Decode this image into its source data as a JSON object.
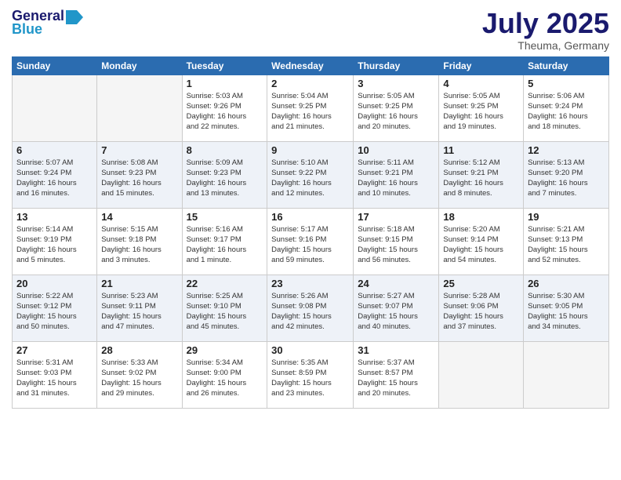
{
  "header": {
    "logo_line1": "General",
    "logo_line2": "Blue",
    "month": "July 2025",
    "location": "Theuma, Germany"
  },
  "days_of_week": [
    "Sunday",
    "Monday",
    "Tuesday",
    "Wednesday",
    "Thursday",
    "Friday",
    "Saturday"
  ],
  "weeks": [
    [
      {
        "day": "",
        "info": ""
      },
      {
        "day": "",
        "info": ""
      },
      {
        "day": "1",
        "info": "Sunrise: 5:03 AM\nSunset: 9:26 PM\nDaylight: 16 hours\nand 22 minutes."
      },
      {
        "day": "2",
        "info": "Sunrise: 5:04 AM\nSunset: 9:25 PM\nDaylight: 16 hours\nand 21 minutes."
      },
      {
        "day": "3",
        "info": "Sunrise: 5:05 AM\nSunset: 9:25 PM\nDaylight: 16 hours\nand 20 minutes."
      },
      {
        "day": "4",
        "info": "Sunrise: 5:05 AM\nSunset: 9:25 PM\nDaylight: 16 hours\nand 19 minutes."
      },
      {
        "day": "5",
        "info": "Sunrise: 5:06 AM\nSunset: 9:24 PM\nDaylight: 16 hours\nand 18 minutes."
      }
    ],
    [
      {
        "day": "6",
        "info": "Sunrise: 5:07 AM\nSunset: 9:24 PM\nDaylight: 16 hours\nand 16 minutes."
      },
      {
        "day": "7",
        "info": "Sunrise: 5:08 AM\nSunset: 9:23 PM\nDaylight: 16 hours\nand 15 minutes."
      },
      {
        "day": "8",
        "info": "Sunrise: 5:09 AM\nSunset: 9:23 PM\nDaylight: 16 hours\nand 13 minutes."
      },
      {
        "day": "9",
        "info": "Sunrise: 5:10 AM\nSunset: 9:22 PM\nDaylight: 16 hours\nand 12 minutes."
      },
      {
        "day": "10",
        "info": "Sunrise: 5:11 AM\nSunset: 9:21 PM\nDaylight: 16 hours\nand 10 minutes."
      },
      {
        "day": "11",
        "info": "Sunrise: 5:12 AM\nSunset: 9:21 PM\nDaylight: 16 hours\nand 8 minutes."
      },
      {
        "day": "12",
        "info": "Sunrise: 5:13 AM\nSunset: 9:20 PM\nDaylight: 16 hours\nand 7 minutes."
      }
    ],
    [
      {
        "day": "13",
        "info": "Sunrise: 5:14 AM\nSunset: 9:19 PM\nDaylight: 16 hours\nand 5 minutes."
      },
      {
        "day": "14",
        "info": "Sunrise: 5:15 AM\nSunset: 9:18 PM\nDaylight: 16 hours\nand 3 minutes."
      },
      {
        "day": "15",
        "info": "Sunrise: 5:16 AM\nSunset: 9:17 PM\nDaylight: 16 hours\nand 1 minute."
      },
      {
        "day": "16",
        "info": "Sunrise: 5:17 AM\nSunset: 9:16 PM\nDaylight: 15 hours\nand 59 minutes."
      },
      {
        "day": "17",
        "info": "Sunrise: 5:18 AM\nSunset: 9:15 PM\nDaylight: 15 hours\nand 56 minutes."
      },
      {
        "day": "18",
        "info": "Sunrise: 5:20 AM\nSunset: 9:14 PM\nDaylight: 15 hours\nand 54 minutes."
      },
      {
        "day": "19",
        "info": "Sunrise: 5:21 AM\nSunset: 9:13 PM\nDaylight: 15 hours\nand 52 minutes."
      }
    ],
    [
      {
        "day": "20",
        "info": "Sunrise: 5:22 AM\nSunset: 9:12 PM\nDaylight: 15 hours\nand 50 minutes."
      },
      {
        "day": "21",
        "info": "Sunrise: 5:23 AM\nSunset: 9:11 PM\nDaylight: 15 hours\nand 47 minutes."
      },
      {
        "day": "22",
        "info": "Sunrise: 5:25 AM\nSunset: 9:10 PM\nDaylight: 15 hours\nand 45 minutes."
      },
      {
        "day": "23",
        "info": "Sunrise: 5:26 AM\nSunset: 9:08 PM\nDaylight: 15 hours\nand 42 minutes."
      },
      {
        "day": "24",
        "info": "Sunrise: 5:27 AM\nSunset: 9:07 PM\nDaylight: 15 hours\nand 40 minutes."
      },
      {
        "day": "25",
        "info": "Sunrise: 5:28 AM\nSunset: 9:06 PM\nDaylight: 15 hours\nand 37 minutes."
      },
      {
        "day": "26",
        "info": "Sunrise: 5:30 AM\nSunset: 9:05 PM\nDaylight: 15 hours\nand 34 minutes."
      }
    ],
    [
      {
        "day": "27",
        "info": "Sunrise: 5:31 AM\nSunset: 9:03 PM\nDaylight: 15 hours\nand 31 minutes."
      },
      {
        "day": "28",
        "info": "Sunrise: 5:33 AM\nSunset: 9:02 PM\nDaylight: 15 hours\nand 29 minutes."
      },
      {
        "day": "29",
        "info": "Sunrise: 5:34 AM\nSunset: 9:00 PM\nDaylight: 15 hours\nand 26 minutes."
      },
      {
        "day": "30",
        "info": "Sunrise: 5:35 AM\nSunset: 8:59 PM\nDaylight: 15 hours\nand 23 minutes."
      },
      {
        "day": "31",
        "info": "Sunrise: 5:37 AM\nSunset: 8:57 PM\nDaylight: 15 hours\nand 20 minutes."
      },
      {
        "day": "",
        "info": ""
      },
      {
        "day": "",
        "info": ""
      }
    ]
  ]
}
